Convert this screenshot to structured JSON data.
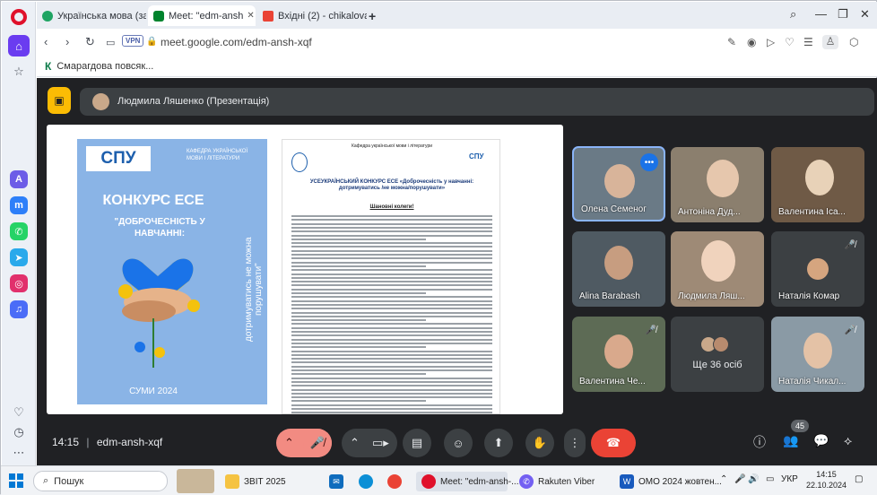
{
  "browser": {
    "tabs": [
      {
        "title": "Українська мова (за проф"
      },
      {
        "title": "Meet: \"edm-ansh"
      },
      {
        "title": "Вхідні (2) - chikalovan200"
      }
    ],
    "url": "meet.google.com/edm-ansh-xqf",
    "vpn_label": "VPN",
    "bookmark": "Смарагдова повсяк...",
    "bookmark_icon_letter": "К"
  },
  "meet": {
    "presenter": "Людмила Ляшенко (Презентація)",
    "meeting_time": "14:15",
    "meeting_code": "edm-ansh-xqf",
    "participant_count": "45",
    "more_people": "Ще 36 осіб",
    "participants": [
      {
        "name": "Олена Семеног",
        "muted": false
      },
      {
        "name": "Антоніна Дуд...",
        "muted": false
      },
      {
        "name": "Валентина Іса...",
        "muted": false
      },
      {
        "name": "Alina Barabash",
        "muted": false
      },
      {
        "name": "Людмила Ляш...",
        "muted": false
      },
      {
        "name": "Наталія Комар",
        "muted": true
      },
      {
        "name": "Валентина Че...",
        "muted": true
      },
      {
        "name": "Наталія Чикал...",
        "muted": true
      }
    ]
  },
  "slide": {
    "logo": "СПУ",
    "dept": "КАФЕДРА УКРАЇНСЬКОЇ МОВИ І ЛІТЕРАТУРИ",
    "title": "КОНКУРС ЕСЕ",
    "subtitle": "\"ДОБРОЧЕСНІСТЬ У НАВЧАННІ:",
    "vertical_text": "дотримуватись не можна порушувати\"",
    "footer": "СУМИ 2024",
    "doc_header": "Кафедра української мови і літератури",
    "doc_title": "УСЕУКРАЇНСЬКИЙ КОНКУРС ЕСЕ «Доброчесність у навчанні: дотримуватись /не можна/порушувати»",
    "doc_greeting": "Шановні колеги!"
  },
  "taskbar": {
    "search": "Пошук",
    "items": [
      "ЗВІТ 2025",
      "Meet: \"edm-ansh-...",
      "Rakuten Viber",
      "ОМО 2024 жовтен..."
    ],
    "lang": "УКР",
    "time": "14:15",
    "date": "22.10.2024"
  }
}
